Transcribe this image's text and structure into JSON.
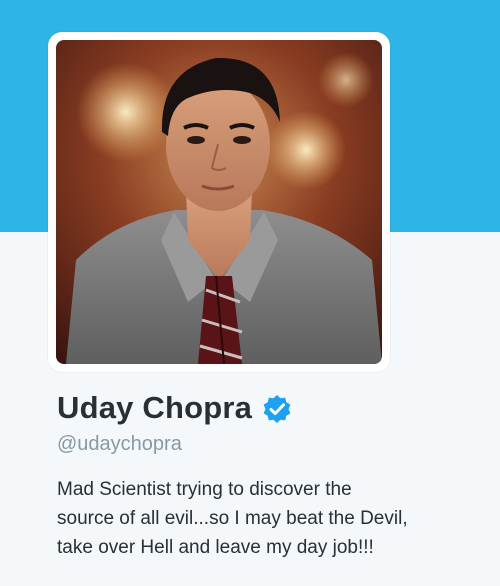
{
  "profile": {
    "name": "Uday Chopra",
    "handle": "@udaychopra",
    "bio_lines": [
      "Mad Scientist trying to discover the",
      "source of all evil...so I may beat the Devil,",
      "take over Hell and leave my day job!!!"
    ],
    "avatar_icon": "profile-photo",
    "verified_icon": "verified-badge-icon"
  },
  "colors": {
    "banner": "#2eb4e6",
    "background": "#f5f8fa",
    "name_text": "#292f33",
    "handle_text": "#8899a6",
    "verified_badge": "#1da1f2"
  }
}
